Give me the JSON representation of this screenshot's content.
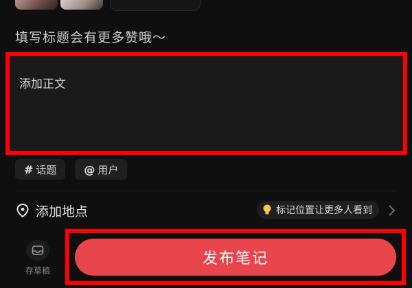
{
  "editor": {
    "title_placeholder": "填写标题会有更多赞哦～",
    "body_placeholder": "添加正文"
  },
  "tags": [
    {
      "symbol": "#",
      "label": "话题"
    },
    {
      "symbol": "@",
      "label": "用户"
    }
  ],
  "location": {
    "label": "添加地点",
    "hint": "标记位置让更多人看到"
  },
  "footer": {
    "draft_label": "存草稿",
    "publish_label": "发布笔记"
  },
  "icons": {
    "pin": "location-pin-icon",
    "bulb": "lightbulb-icon",
    "chevron": "chevron-right-icon",
    "draft": "draft-box-icon"
  },
  "colors": {
    "accent": "#e8454c",
    "highlight_border": "#ff0000",
    "background": "#0f0f0f"
  }
}
